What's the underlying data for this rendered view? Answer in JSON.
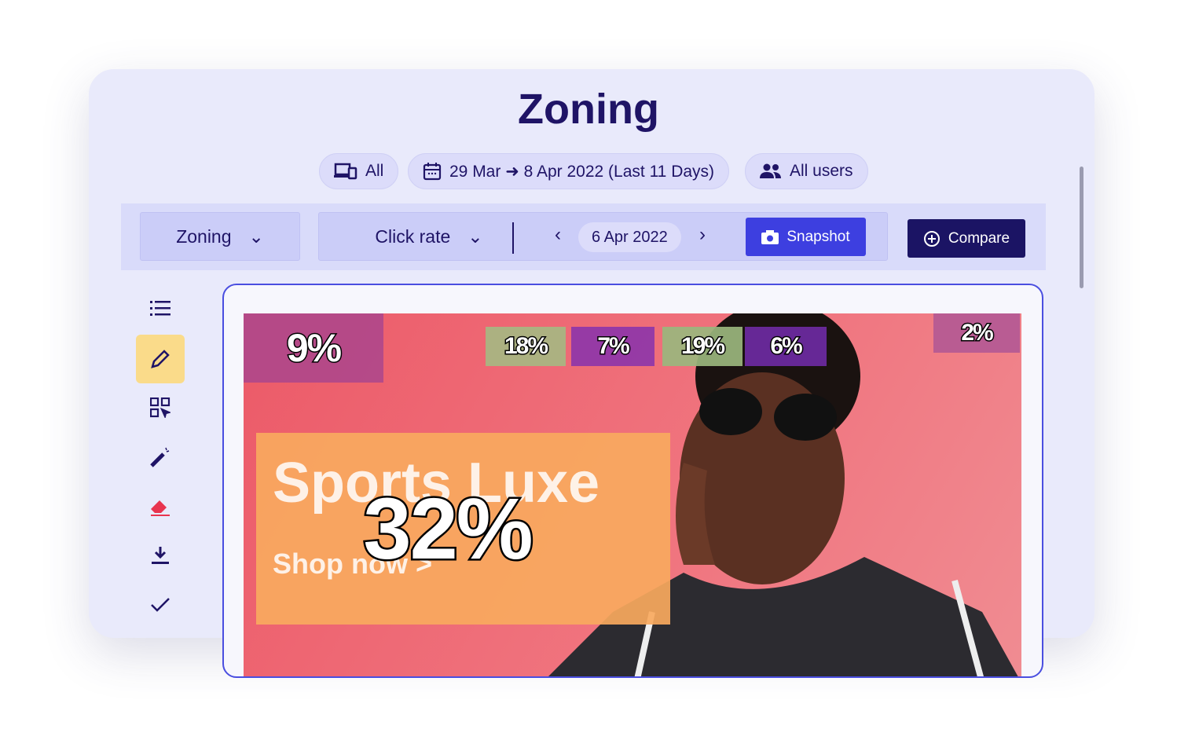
{
  "title": "Zoning",
  "filters": {
    "device": "All",
    "date_range": "29 Mar ➜ 8 Apr 2022 (Last 11 Days)",
    "segment": "All users"
  },
  "toolbar": {
    "view": "Zoning",
    "metric": "Click rate",
    "date": "6 Apr 2022",
    "snapshot": "Snapshot",
    "compare": "Compare"
  },
  "sidebar": {
    "icons": [
      "list-icon",
      "pencil-icon",
      "zones-icon",
      "magic-wand-icon",
      "eraser-icon",
      "download-icon",
      "check-icon"
    ],
    "active": "pencil-icon"
  },
  "preview": {
    "headline": "Sports Luxe",
    "cta": "Shop now >",
    "zones": [
      {
        "value": "9%",
        "color": "#b0488a"
      },
      {
        "value": "18%",
        "color": "#a6b782"
      },
      {
        "value": "7%",
        "color": "#8e36a9"
      },
      {
        "value": "19%",
        "color": "#9ab67d"
      },
      {
        "value": "6%",
        "color": "#6c2aa2"
      },
      {
        "value": "2%",
        "color": "#b45994"
      },
      {
        "value": "32%",
        "color": "#f9a95e"
      }
    ]
  },
  "colors": {
    "accent": "#3d3fe0",
    "dark": "#1b1464",
    "active": "#fadb8a"
  }
}
